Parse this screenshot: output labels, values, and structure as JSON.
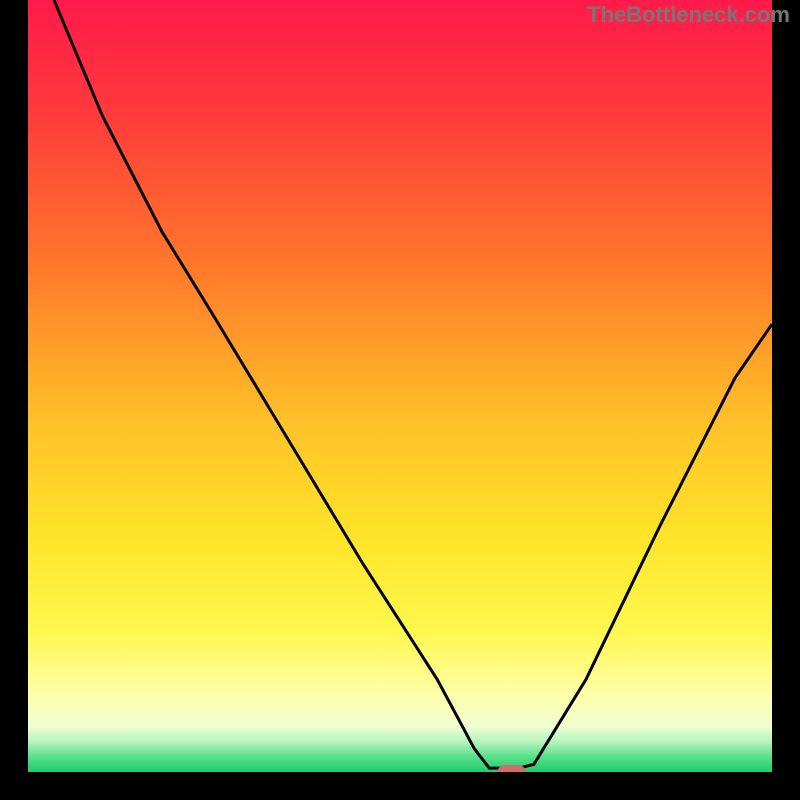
{
  "watermark": "TheBottleneck.com",
  "chart_data": {
    "type": "line",
    "title": "",
    "xlabel": "",
    "ylabel": "",
    "xlim": [
      0,
      100
    ],
    "ylim": [
      0,
      100
    ],
    "curve_points": [
      {
        "x": 3.5,
        "y": 100
      },
      {
        "x": 10,
        "y": 85
      },
      {
        "x": 18,
        "y": 70
      },
      {
        "x": 25,
        "y": 59
      },
      {
        "x": 35,
        "y": 43
      },
      {
        "x": 45,
        "y": 27
      },
      {
        "x": 55,
        "y": 12
      },
      {
        "x": 60,
        "y": 3
      },
      {
        "x": 62,
        "y": 0.5
      },
      {
        "x": 66,
        "y": 0.5
      },
      {
        "x": 68,
        "y": 1
      },
      {
        "x": 75,
        "y": 12
      },
      {
        "x": 85,
        "y": 32
      },
      {
        "x": 95,
        "y": 51
      },
      {
        "x": 100,
        "y": 58
      }
    ],
    "marker": {
      "x": 65,
      "y": 0,
      "color": "#d46a6a"
    },
    "gradient_stops": [
      {
        "offset": 0,
        "color": "#ff1a4a"
      },
      {
        "offset": 15,
        "color": "#ff3b3b"
      },
      {
        "offset": 35,
        "color": "#ff7a2a"
      },
      {
        "offset": 55,
        "color": "#ffc229"
      },
      {
        "offset": 70,
        "color": "#ffe529"
      },
      {
        "offset": 82,
        "color": "#fff850"
      },
      {
        "offset": 90,
        "color": "#fdffa8"
      },
      {
        "offset": 94,
        "color": "#f0ffd0"
      },
      {
        "offset": 96,
        "color": "#b8f5c0"
      },
      {
        "offset": 98,
        "color": "#5ae089"
      },
      {
        "offset": 100,
        "color": "#1ecb70"
      }
    ],
    "border_color": "#000000",
    "border_width": 28
  }
}
